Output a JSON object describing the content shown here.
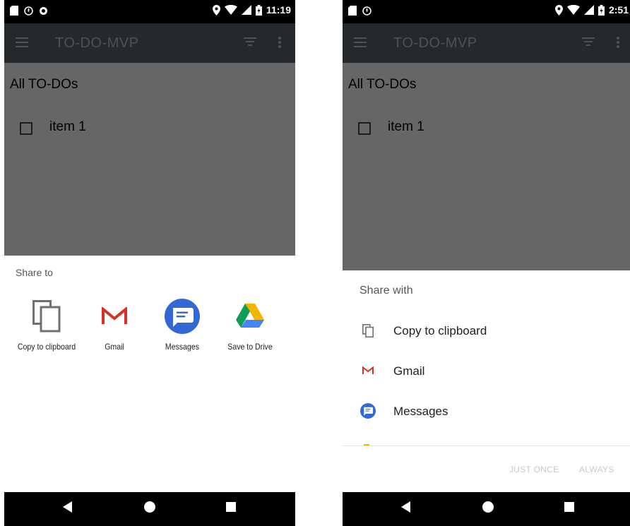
{
  "colors": {
    "app_bar": "#25292b",
    "scrim_content": "#666666",
    "status_bar": "#000000",
    "nav_bar": "#000000",
    "gmail_red": "#d93025",
    "messages_blue": "#3367d6"
  },
  "left": {
    "status": {
      "time": "11:19"
    },
    "app_bar": {
      "title": "TO-DO-MVP"
    },
    "list": {
      "title": "All TO-DOs",
      "items": [
        {
          "label": "item 1"
        }
      ]
    },
    "share_sheet": {
      "title": "Share to",
      "targets": [
        {
          "label": "Copy to clipboard",
          "icon": "copy-icon"
        },
        {
          "label": "Gmail",
          "icon": "gmail-icon"
        },
        {
          "label": "Messages",
          "icon": "messages-icon"
        },
        {
          "label": "Save to Drive",
          "icon": "drive-icon"
        }
      ]
    }
  },
  "right": {
    "status": {
      "time": "2:51"
    },
    "app_bar": {
      "title": "TO-DO-MVP"
    },
    "list": {
      "title": "All TO-DOs",
      "items": [
        {
          "label": "item 1"
        }
      ]
    },
    "share_sheet": {
      "title": "Share with",
      "targets": [
        {
          "label": "Copy to clipboard",
          "icon": "copy-icon"
        },
        {
          "label": "Gmail",
          "icon": "gmail-icon"
        },
        {
          "label": "Messages",
          "icon": "messages-icon"
        }
      ],
      "actions": {
        "just_once": "JUST ONCE",
        "always": "ALWAYS"
      }
    }
  },
  "nav": {
    "icons": [
      "back-icon",
      "home-icon",
      "recents-icon"
    ]
  }
}
